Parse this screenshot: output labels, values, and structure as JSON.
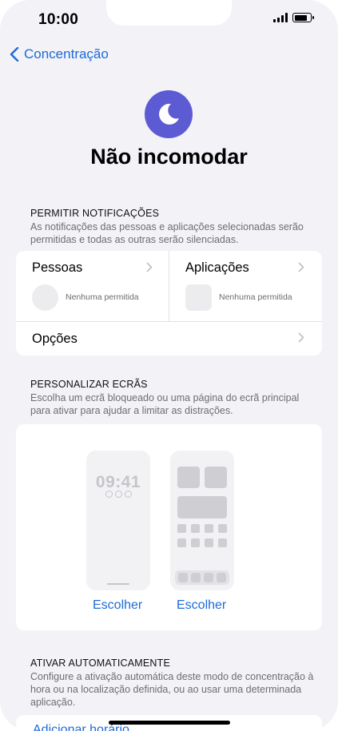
{
  "status_bar": {
    "time": "10:00",
    "battery_level": 0.85
  },
  "nav": {
    "back_label": "Concentração"
  },
  "focus": {
    "title": "Não incomodar",
    "icon": "moon-icon",
    "icon_color": "#5d5bd4"
  },
  "allow_notifications": {
    "header": "PERMITIR NOTIFICAÇÕES",
    "description": "As notificações das pessoas e aplicações selecionadas serão permitidas e todas as outras serão silenciadas.",
    "people": {
      "label": "Pessoas",
      "status": "Nenhuma permitida"
    },
    "apps": {
      "label": "Aplicações",
      "status": "Nenhuma permitida"
    },
    "options": {
      "label": "Opções"
    }
  },
  "customize_screens": {
    "header": "PERSONALIZAR ECRÃS",
    "description": "Escolha um ecrã bloqueado ou uma página do ecrã principal para ativar para ajudar a limitar as distrações.",
    "lock_screen_time": "09:41",
    "lock_choose": "Escolher",
    "home_choose": "Escolher"
  },
  "auto_activate": {
    "header": "ATIVAR AUTOMATICAMENTE",
    "description": "Configure a ativação automática deste modo de concentração à hora ou na localização definida, ou ao usar uma determinada aplicação.",
    "add_schedule": "Adicionar horário"
  },
  "colors": {
    "accent": "#1e6bd6",
    "background": "#f2f2f7"
  }
}
